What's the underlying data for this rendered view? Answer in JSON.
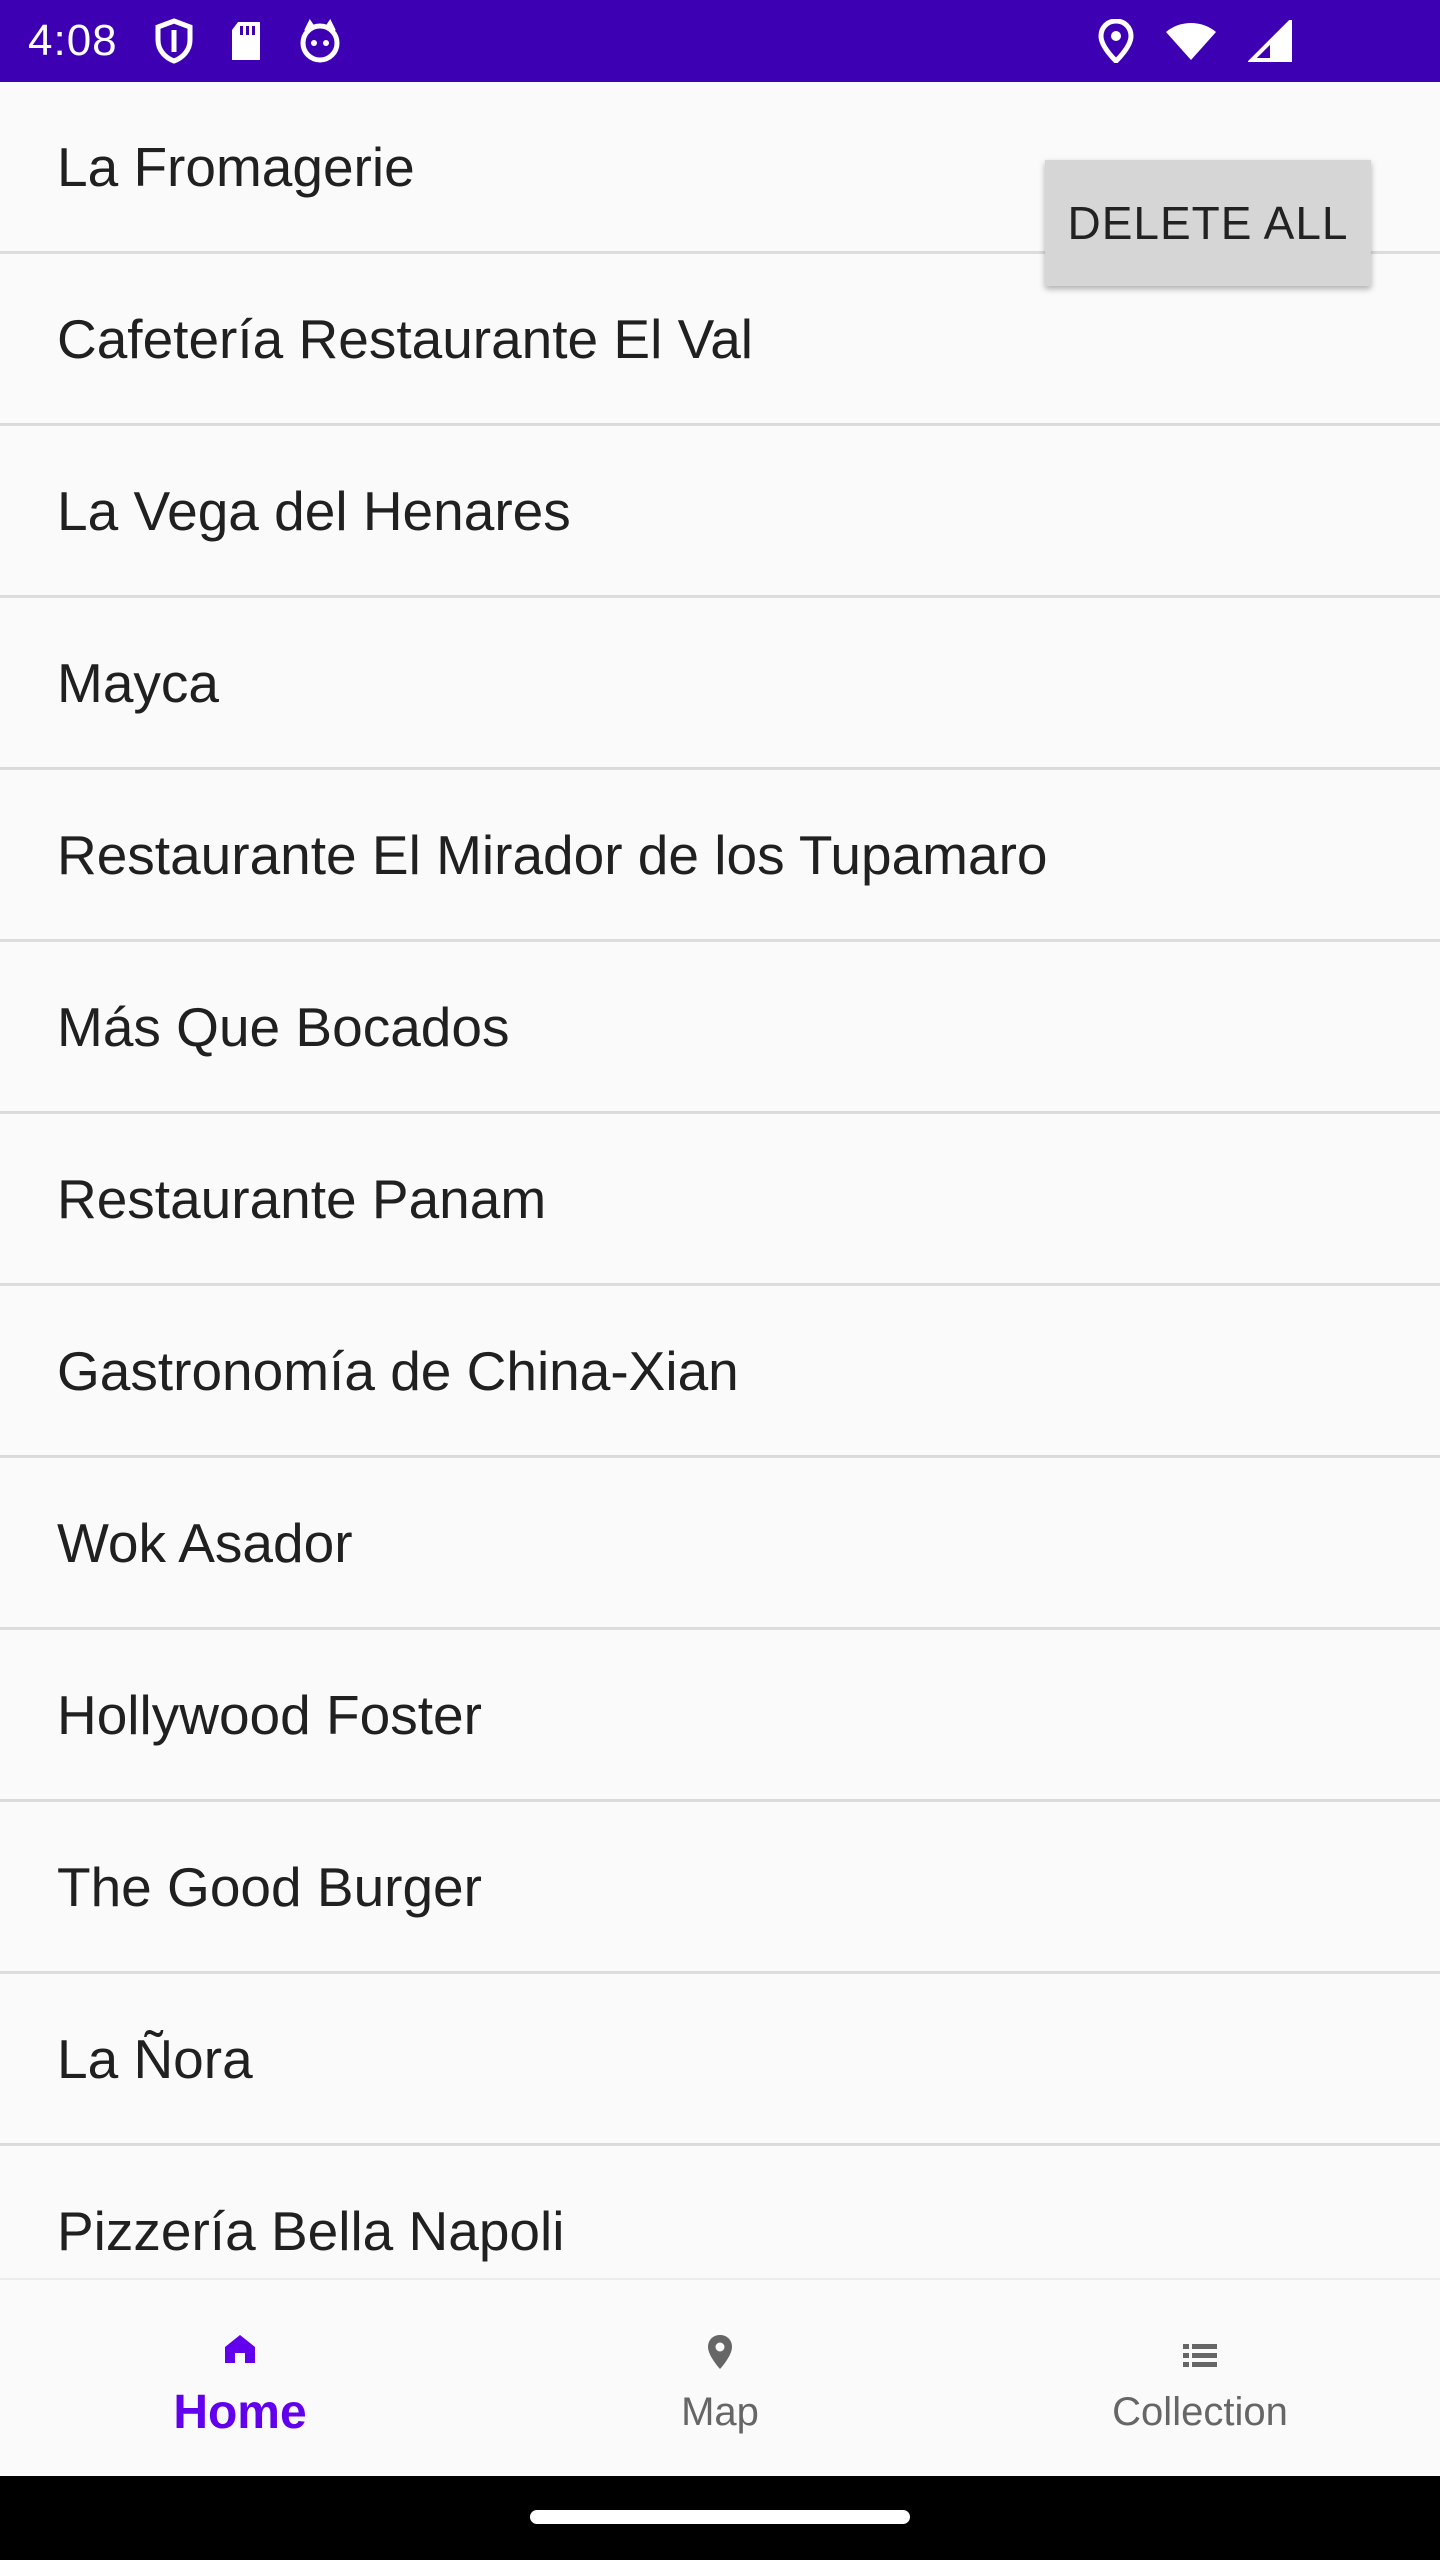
{
  "status_bar": {
    "time": "4:08",
    "left_icons": [
      "shield-icon",
      "sd-card-icon",
      "app-notification-icon"
    ],
    "right_icons": [
      "location-icon",
      "wifi-icon",
      "signal-icon"
    ],
    "background_color": "#3d00b3"
  },
  "restaurants": [
    "La Fromagerie",
    "Cafetería Restaurante El Val",
    "La Vega del Henares",
    "Mayca",
    "Restaurante El Mirador de los Tupamaro",
    "Más Que Bocados",
    "Restaurante Panam",
    "Gastronomía de China-Xian",
    "Wok Asador",
    "Hollywood Foster",
    "The Good Burger",
    "La Ñora",
    "Pizzería Bella Napoli"
  ],
  "delete_all_label": "DELETE ALL",
  "bottom_nav": {
    "active_color": "#6200ee",
    "items": [
      {
        "label": "Home",
        "icon": "home-icon",
        "active": true
      },
      {
        "label": "Map",
        "icon": "map-pin-icon",
        "active": false
      },
      {
        "label": "Collection",
        "icon": "list-icon",
        "active": false
      }
    ]
  }
}
